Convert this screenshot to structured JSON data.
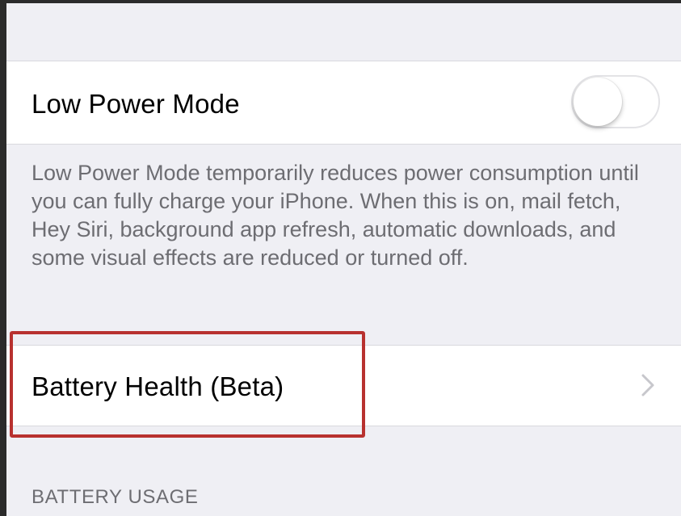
{
  "low_power": {
    "label": "Low Power Mode",
    "toggle_state": "off",
    "footer": "Low Power Mode temporarily reduces power consumption until you can fully charge your iPhone. When this is on, mail fetch, Hey Siri, background app refresh, automatic downloads, and some visual effects are reduced or turned off."
  },
  "battery_health": {
    "label": "Battery Health (Beta)",
    "chevron_icon": "chevron-right-icon"
  },
  "battery_usage": {
    "header": "BATTERY USAGE"
  },
  "colors": {
    "highlight": "#b8312f",
    "background": "#efeff4",
    "footer_text": "#6d6d72"
  }
}
